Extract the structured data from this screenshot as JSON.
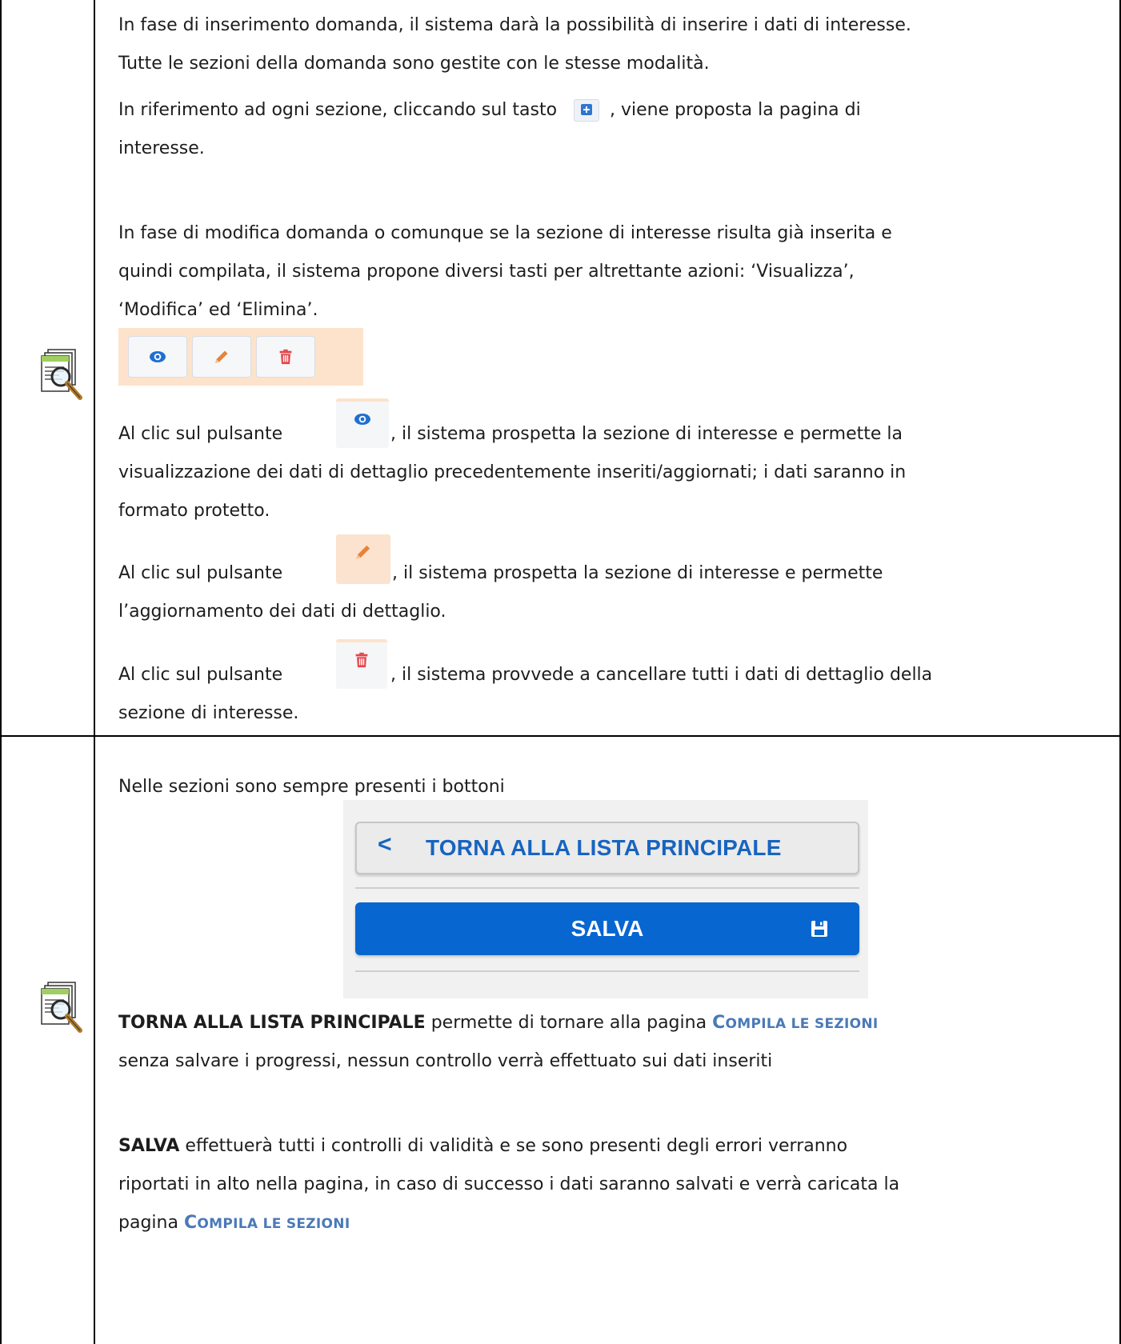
{
  "section1": {
    "line1": "In fase di inserimento domanda, il sistema darà la possibilità di inserire i dati di interesse.",
    "line2": "Tutte le sezioni della domanda sono gestite con le stesse modalità.",
    "line3a": "In riferimento ad ogni sezione, cliccando sul tasto",
    "line3b": ", viene proposta la pagina di",
    "line4": "interesse.",
    "line5": "In fase di modifica domanda o comunque se la sezione di interesse risulta già inserita e",
    "line6": "quindi compilata, il sistema propone diversi tasti per altrettante azioni: ‘Visualizza’,",
    "line7": "‘Modifica’ ed ‘Elimina’.",
    "view_a": "Al clic sul pulsante",
    "view_b": ", il sistema prospetta la sezione di interesse e permette la",
    "view_c": "visualizzazione dei dati di dettaglio precedentemente inseriti/aggiornati; i dati saranno in",
    "view_d": "formato protetto.",
    "edit_a": "Al clic sul pulsante",
    "edit_b": ", il sistema prospetta la sezione di interesse e permette",
    "edit_c": "l’aggiornamento dei dati di dettaglio.",
    "del_a": "Al clic sul pulsante",
    "del_b": ", il sistema provvede a cancellare tutti i dati di dettaglio della",
    "del_c": "sezione di interesse."
  },
  "section2": {
    "intro": "Nelle sezioni sono sempre presenti i bottoni",
    "back_chevron": "<",
    "back_label": "TORNA ALLA LISTA PRINCIPALE",
    "save_label": "SALVA",
    "desc1_bold": "TORNA ALLA LISTA PRINCIPALE",
    "desc1_mid": " permette di tornare alla pagina ",
    "link_first": "C",
    "link_rest": "OMPILA LE SEZIONI",
    "desc1_line2": "senza salvare i progressi, nessun controllo verrà effettuato sui dati inseriti",
    "desc2_bold": "SALVA",
    "desc2_rest": " effettuerà tutti i controlli di validità e se sono presenti degli errori verranno",
    "desc2_line2": "riportati in alto nella pagina, in caso di successo i dati saranno salvati e verrà caricata la",
    "desc2_line3": "pagina "
  },
  "icons": {
    "side": "magnifier-document-icon",
    "add": "plus-square-icon",
    "view": "eye-icon",
    "edit": "pencil-icon",
    "delete": "trash-icon",
    "save": "floppy-disk-icon"
  },
  "colors": {
    "accent": "#0866d0",
    "link": "#4a79b8",
    "action_bar_bg": "#fde3cc",
    "view_icon": "#1f6fd1",
    "edit_icon": "#e8833a",
    "delete_icon": "#e2454a"
  }
}
